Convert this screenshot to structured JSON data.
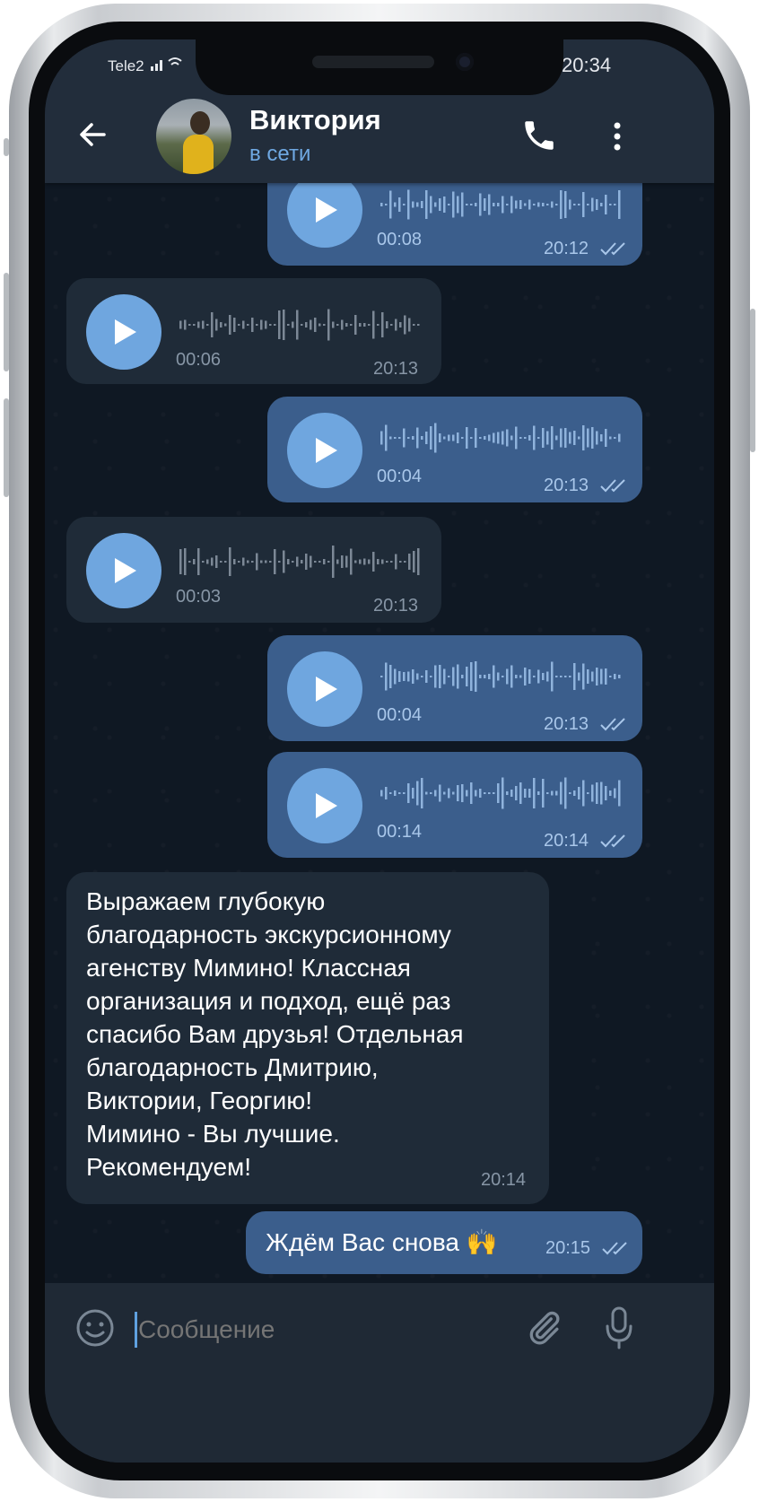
{
  "status_bar": {
    "carrier": "Tele2",
    "time": "20:34"
  },
  "header": {
    "back_icon": "arrow-left-icon",
    "contact_name": "Виктория",
    "contact_status": "в сети",
    "call_icon": "phone-icon",
    "menu_icon": "more-vertical-icon"
  },
  "messages": [
    {
      "type": "voice",
      "direction": "outgoing",
      "duration": "00:08",
      "time": "20:12"
    },
    {
      "type": "voice",
      "direction": "incoming",
      "duration": "00:06",
      "time": "20:13"
    },
    {
      "type": "voice",
      "direction": "outgoing",
      "duration": "00:04",
      "time": "20:13"
    },
    {
      "type": "voice",
      "direction": "incoming",
      "duration": "00:03",
      "time": "20:13"
    },
    {
      "type": "voice",
      "direction": "outgoing",
      "duration": "00:04",
      "time": "20:13"
    },
    {
      "type": "voice",
      "direction": "outgoing",
      "duration": "00:14",
      "time": "20:14"
    },
    {
      "type": "text",
      "direction": "incoming",
      "text": "Выражаем глубокую\nблагодарность экскурсионному\nагенству Мимино! Классная\nорганизация и подход, ещё раз\nспасибо Вам друзья! Отдельная\nблагодарность Дмитрию,\nВиктории, Георгию!\nМимино - Вы лучшие.\nРекомендуем!",
      "time": "20:14"
    },
    {
      "type": "text",
      "direction": "outgoing",
      "text": "Ждём Вас снова 🙌",
      "time": "20:15"
    }
  ],
  "input": {
    "placeholder": "Сообщение",
    "emoji_icon": "emoji-icon",
    "attach_icon": "paperclip-icon",
    "mic_icon": "microphone-icon"
  },
  "colors": {
    "outgoing_bubble": "#3b5e8c",
    "incoming_bubble": "#1f2b38",
    "accent": "#6fa6df",
    "background": "#0f1823"
  }
}
